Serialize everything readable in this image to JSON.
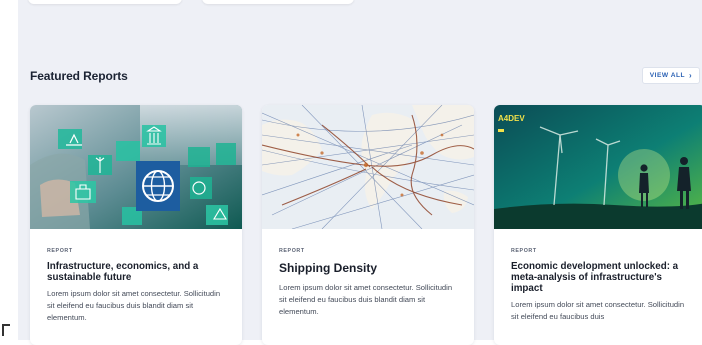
{
  "section": {
    "title": "Featured Reports",
    "view_all_label": "VIEW ALL",
    "view_all_icon": "chevron-right-icon"
  },
  "reports": [
    {
      "tag": "REPORT",
      "title": "Infrastructure, economics, and a sustainable future",
      "description": "Lorem ipsum dolor sit amet consectetur. Sollicitudin sit eleifend eu faucibus duis blandit diam sit elementum."
    },
    {
      "tag": "REPORT",
      "title": "Shipping Density",
      "description": "Lorem ipsum dolor sit amet consectetur. Sollicitudin sit eleifend eu faucibus duis blandit diam sit elementum."
    },
    {
      "tag": "REPORT",
      "title": "Economic development unlocked: a meta-analysis of infrastructure's impact",
      "description": "Lorem ipsum dolor sit amet consectetur. Sollicitudin sit eleifend eu faucibus duis",
      "image_badge": "A4DEV"
    }
  ],
  "colors": {
    "accent": "#2c62b4",
    "panel_background": "#eef0f6",
    "teal": "#19a990"
  }
}
